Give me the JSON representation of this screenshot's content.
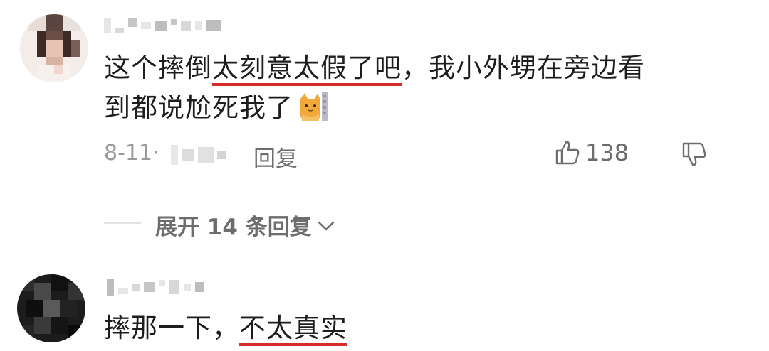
{
  "comments": [
    {
      "text_parts": [
        "这个摔倒",
        "太刻意太假了吧",
        "，我小外甥在旁边看",
        "到都说尬死我了"
      ],
      "emoji_icon": "cat-emoji-icon",
      "date": "8-11·",
      "reply_label": "回复",
      "like_count": "138",
      "expand_label": "展开 14 条回复"
    },
    {
      "text_parts": [
        "摔那一下，",
        "不太真实"
      ]
    }
  ],
  "colors": {
    "highlight_underline": "#d52b2b",
    "meta_text": "#9a9a9a",
    "action_text": "#6d6d6d"
  }
}
